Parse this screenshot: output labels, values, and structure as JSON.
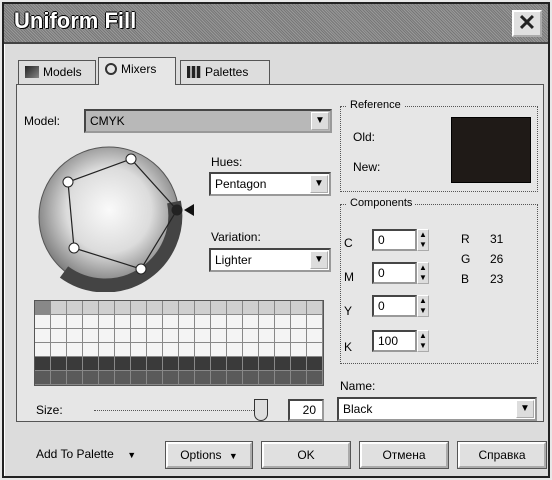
{
  "window": {
    "title": "Uniform Fill"
  },
  "tabs": [
    {
      "label": "Models",
      "icon": "color-model-icon"
    },
    {
      "label": "Mixers",
      "icon": "mixer-icon"
    },
    {
      "label": "Palettes",
      "icon": "palette-icon"
    }
  ],
  "model": {
    "label": "Model:",
    "value": "CMYK"
  },
  "hues": {
    "label": "Hues:",
    "value": "Pentagon"
  },
  "variation": {
    "label": "Variation:",
    "value": "Lighter"
  },
  "reference": {
    "title": "Reference",
    "old_label": "Old:",
    "new_label": "New:",
    "old_color": "#1f1a17"
  },
  "components": {
    "title": "Components",
    "cmyk": [
      {
        "label": "C",
        "value": "0"
      },
      {
        "label": "M",
        "value": "0"
      },
      {
        "label": "Y",
        "value": "0"
      },
      {
        "label": "K",
        "value": "100"
      }
    ],
    "rgb": [
      {
        "label": "R",
        "value": "31"
      },
      {
        "label": "G",
        "value": "26"
      },
      {
        "label": "B",
        "value": "23"
      }
    ]
  },
  "name": {
    "label": "Name:",
    "value": "Black"
  },
  "size": {
    "label": "Size:",
    "value": "20"
  },
  "buttons": {
    "add_to_palette": "Add To Palette",
    "options": "Options",
    "ok": "OK",
    "cancel": "Отмена",
    "help": "Справка"
  },
  "colors": {
    "dark_swatch": "#3a3a3a",
    "mid_swatch": "#5a5a5a",
    "light_swatch": "#f4f4f4"
  }
}
